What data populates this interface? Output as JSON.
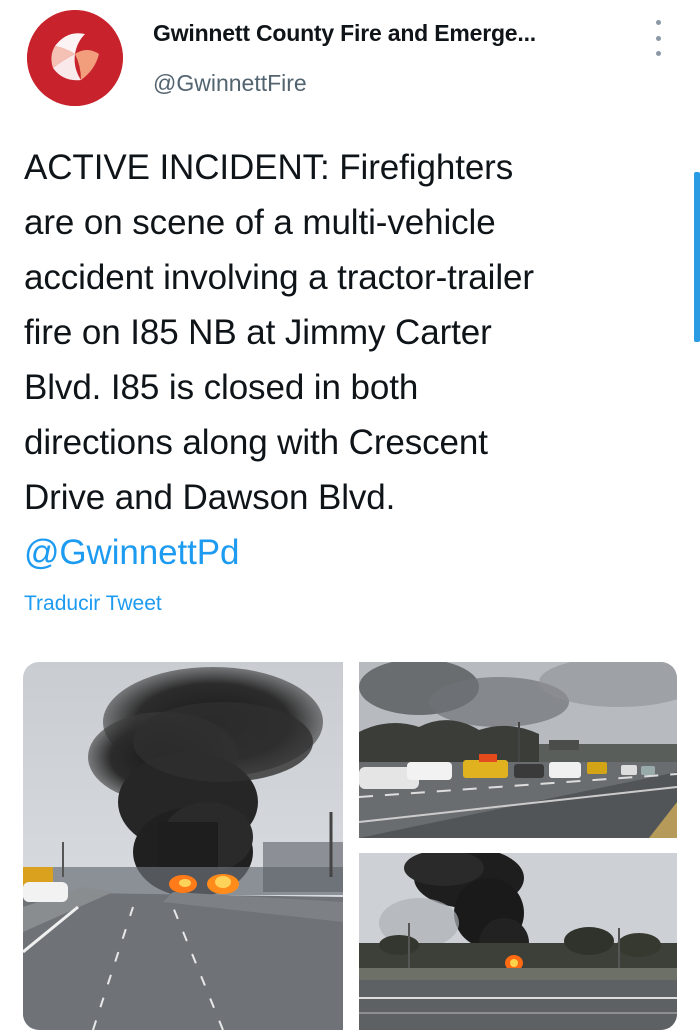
{
  "account": {
    "display_name": "Gwinnett County Fire and Emerge...",
    "handle": "@GwinnettFire",
    "avatar_icon": "gwinnett-fire-logo",
    "brand_color": "#c8232c"
  },
  "tweet": {
    "lines": [
      "ACTIVE INCIDENT: Firefighters",
      "are on scene of a multi-vehicle",
      "accident involving a tractor-trailer",
      "fire on I85 NB at Jimmy Carter",
      "Blvd. I85 is closed in both",
      "directions along with Crescent",
      "Drive and Dawson Blvd."
    ],
    "mention": "@GwinnettPd",
    "translate_label": "Traducir Tweet"
  },
  "colors": {
    "link": "#1d9bf0",
    "text": "#0f1419",
    "secondary": "#536471"
  },
  "media": {
    "count": 3
  }
}
